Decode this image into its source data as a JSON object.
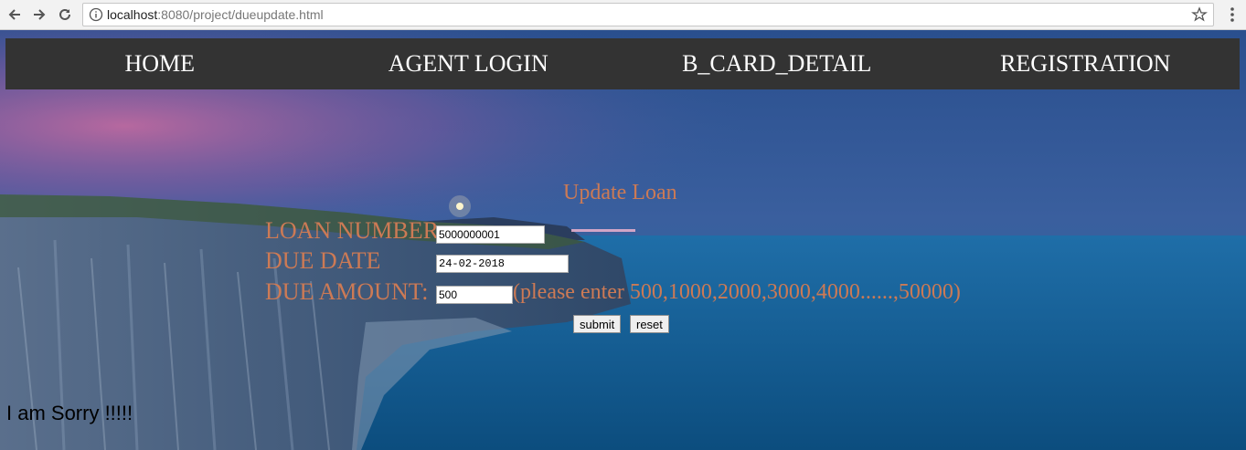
{
  "browser": {
    "url_host": "localhost",
    "url_rest": ":8080/project/dueupdate.html"
  },
  "navbar": {
    "items": [
      {
        "label": "HOME"
      },
      {
        "label": "AGENT LOGIN"
      },
      {
        "label": "B_CARD_DETAIL"
      },
      {
        "label": "REGISTRATION"
      }
    ]
  },
  "form": {
    "title": "Update Loan",
    "loan_number_label": "LOAN NUMBER",
    "loan_number_value": "5000000001",
    "due_date_label": "DUE DATE",
    "due_date_value": "24-02-2018",
    "due_amount_label": "DUE AMOUNT:",
    "due_amount_value": "500",
    "amount_hint": "(please enter 500,1000,2000,3000,4000......,50000)",
    "submit_label": "submit",
    "reset_label": "reset"
  },
  "message": "I am Sorry !!!!!",
  "colors": {
    "navbar_bg": "#333333",
    "label_color": "#cc7a55"
  }
}
